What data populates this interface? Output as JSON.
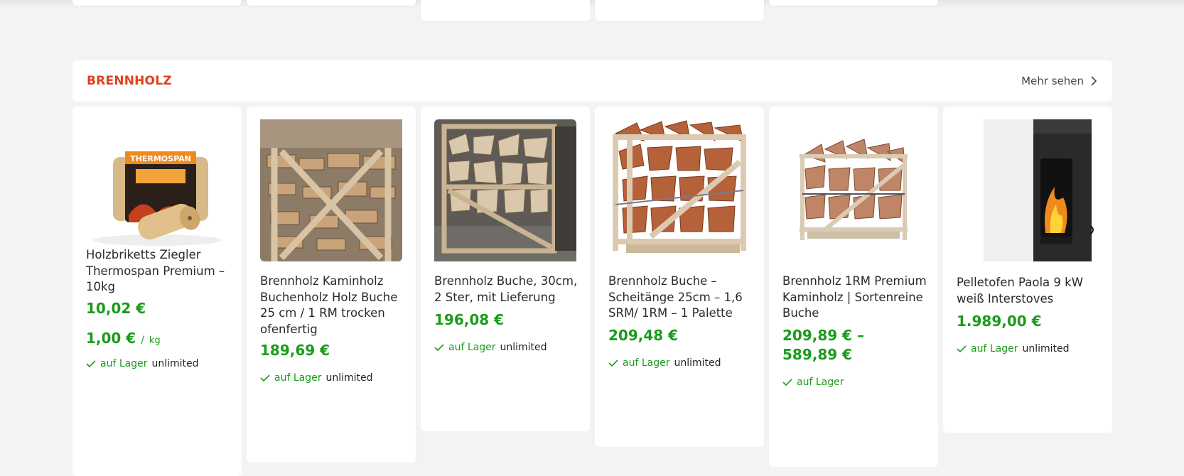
{
  "colors": {
    "accent": "#e0401c",
    "price": "#1a9c1a",
    "background": "#f1f3f4"
  },
  "section": {
    "title": "BRENNHOLZ",
    "more_label": "Mehr sehen"
  },
  "products": [
    {
      "name": "Holzbriketts Ziegler Thermospan Premium – 10kg",
      "price": "10,02 €",
      "unit_price": "1,00 €",
      "unit_sep": "/",
      "unit": "kg",
      "stock_label": "auf Lager",
      "stock_qty": "unlimited",
      "image": "briquettes"
    },
    {
      "name": "Brennholz Kaminholz Buchenholz Holz Buche 25 cm / 1 RM trocken ofenfertig",
      "price": "189,69 €",
      "stock_label": "auf Lager",
      "stock_qty": "unlimited",
      "image": "wood-pallet"
    },
    {
      "name": "Brennholz Buche, 30cm, 2 Ster, mit Lieferung",
      "price": "196,08 €",
      "stock_label": "auf Lager",
      "stock_qty": "unlimited",
      "image": "wood-crates"
    },
    {
      "name": "Brennholz Buche – Scheitänge 25cm – 1,6 SRM/ 1RM – 1 Palette",
      "price": "209,48 €",
      "stock_label": "auf Lager",
      "stock_qty": "unlimited",
      "image": "wood-crate"
    },
    {
      "name": "Brennholz 1RM Premium Kaminholz | Sortenreine Buche",
      "price_line1": "209,89 € –",
      "price_line2": "589,89 €",
      "stock_label": "auf Lager",
      "image": "wood-crate-small"
    },
    {
      "name": "Pelletofen Paola 9 kW weiß Interstoves",
      "price": "1.989,00 €",
      "stock_label": "auf Lager",
      "stock_qty": "unlimited",
      "image": "pellet-stove"
    }
  ]
}
